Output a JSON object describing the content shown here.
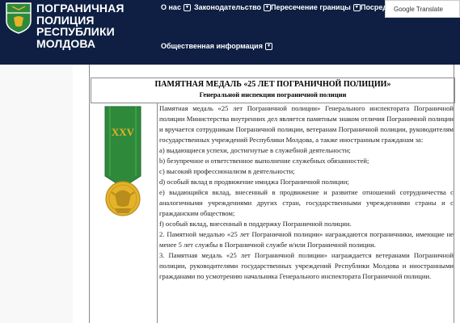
{
  "header": {
    "brand_lines": [
      "ПОГРАНИЧНАЯ",
      "ПОЛИЦИЯ",
      "РЕСПУБЛИКИ",
      "МОЛДОВА"
    ],
    "nav": {
      "about": "О нас",
      "legislation": "Законодательство",
      "crossing": "Пересечение границы",
      "cut": "Посред",
      "public_info": "Общественная информация"
    },
    "translate_label": "Google Translate",
    "colors": {
      "header_bg": "#0e1f43",
      "ribbon": "#2e8a3a",
      "gold": "#e5b32a"
    }
  },
  "article": {
    "title": "ПАМЯТНАЯ МЕДАЛЬ «25 ЛЕТ ПОГРАНИЧНОЙ ПОЛИЦИИ»",
    "subtitle": "Генеральной инспекции пограничной полиции",
    "medal_ribbon_text": "XXV",
    "paragraphs": [
      "Памятная медаль «25 лет Пограничной полиции» Генерального инспектората Пограничной полиции Министерства внутренних дел является памятным знаком отличия Пограничной полиции и вручается сотрудникам Пограничной полиции, ветеранам Пограничной полиции, руководителям государственных учреждений Республики Молдова, а также иностранным гражданам за:",
      "a) выдающиеся успехи, достигнутые в служебной деятельности;",
      "b) безупречное и ответственное выполнение служебных обязанностей;",
      "c) высокий профессионализм в деятельности;",
      "d) особый вклад в продвижение имиджа Пограничной полиции;",
      "e) выдающийся вклад, внесенный в продвижение и развитие отношений сотрудничества с аналогичными учреждениями других стран, государственными учреждениями страны и с гражданским обществом;",
      "f) особый вклад, внесенный в поддержку Пограничной полиции.",
      "2. Памятной медалью «25 лет Пограничной полиции» награждаются пограничники, имеющие не менее 5 лет службы в Пограничной службе и/или Пограничной полиции.",
      "3. Памятная медаль «25 лет Пограничной полиции» награждается ветеранами Пограничной полиции, руководителями государственных учреждений Республики Молдова и иностранными гражданами по усмотрению начальника Генерального инспектората Пограничной полиции."
    ]
  }
}
